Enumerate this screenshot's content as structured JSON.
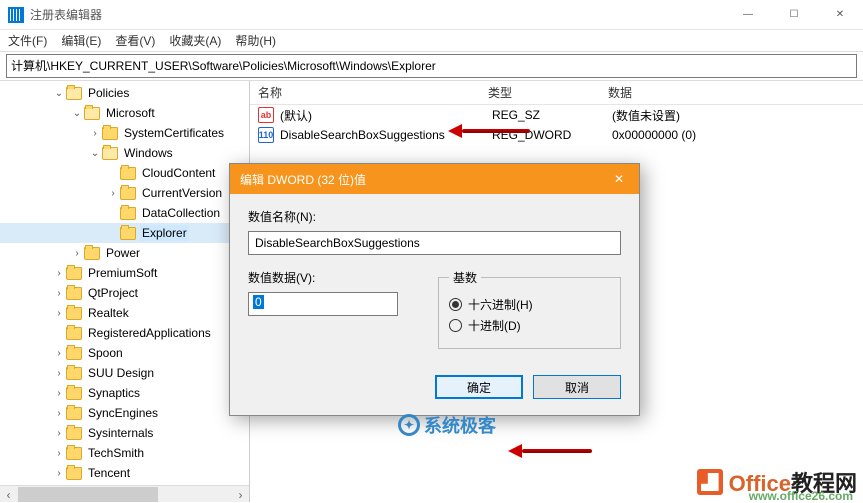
{
  "window": {
    "title": "注册表编辑器",
    "controls": {
      "min": "—",
      "max": "☐",
      "close": "✕"
    }
  },
  "menu": {
    "file": "文件(F)",
    "edit": "编辑(E)",
    "view": "查看(V)",
    "fav": "收藏夹(A)",
    "help": "帮助(H)"
  },
  "address": "计算机\\HKEY_CURRENT_USER\\Software\\Policies\\Microsoft\\Windows\\Explorer",
  "tree": {
    "policies": "Policies",
    "microsoft": "Microsoft",
    "systemcerts": "SystemCertificates",
    "windows": "Windows",
    "cloudcontent": "CloudContent",
    "currentversion": "CurrentVersion",
    "datacollection": "DataCollection",
    "explorer": "Explorer",
    "power": "Power",
    "premiumsoft": "PremiumSoft",
    "qtproject": "QtProject",
    "realtek": "Realtek",
    "regapps": "RegisteredApplications",
    "spoon": "Spoon",
    "suu": "SUU Design",
    "synaptics": "Synaptics",
    "syncengines": "SyncEngines",
    "sysinternals": "Sysinternals",
    "techsmith": "TechSmith",
    "tencent": "Tencent"
  },
  "list": {
    "headers": {
      "name": "名称",
      "type": "类型",
      "data": "数据"
    },
    "rows": [
      {
        "icon": "str",
        "name": "(默认)",
        "type": "REG_SZ",
        "data": "(数值未设置)"
      },
      {
        "icon": "dw",
        "name": "DisableSearchBoxSuggestions",
        "type": "REG_DWORD",
        "data": "0x00000000 (0)"
      }
    ]
  },
  "dialog": {
    "title": "编辑 DWORD (32 位)值",
    "name_label": "数值名称(N):",
    "name_value": "DisableSearchBoxSuggestions",
    "data_label": "数值数据(V):",
    "data_value": "0",
    "radix_label": "基数",
    "radix_hex": "十六进制(H)",
    "radix_dec": "十进制(D)",
    "ok": "确定",
    "cancel": "取消"
  },
  "watermark1": "系统极客",
  "watermark2": {
    "a": "Office",
    "b": "教程网",
    "url": "www.office26.com"
  },
  "icon_text": {
    "str": "ab",
    "dw": "110"
  }
}
